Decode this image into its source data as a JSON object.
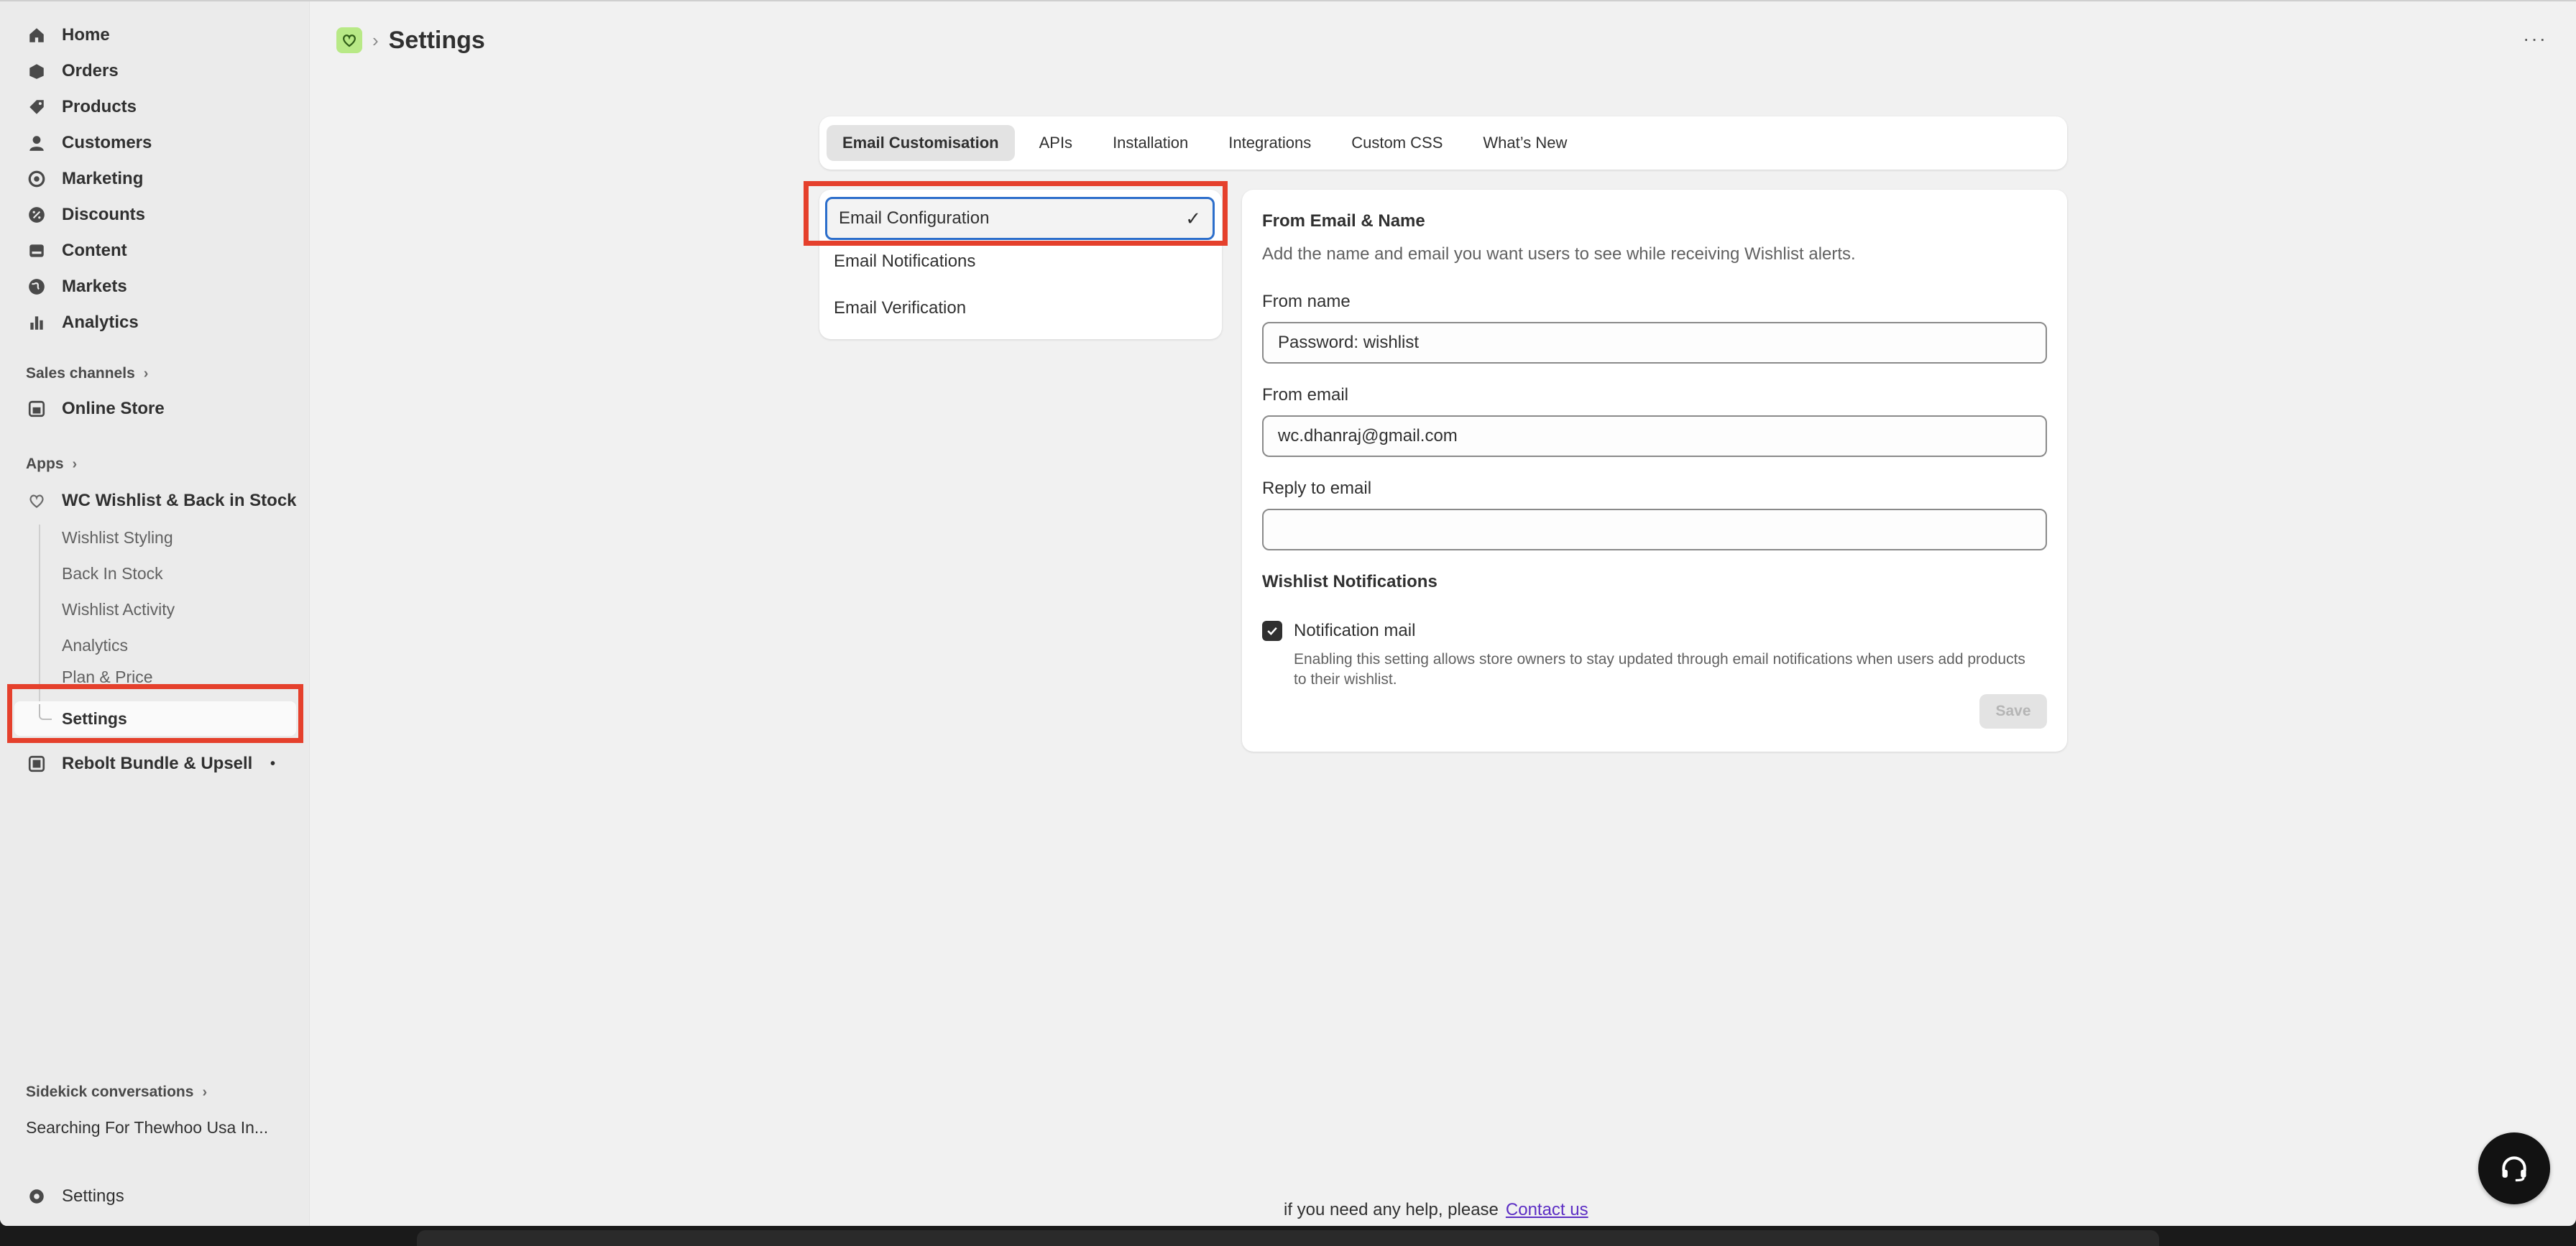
{
  "sidebar": {
    "nav": [
      {
        "label": "Home",
        "icon": "home-icon"
      },
      {
        "label": "Orders",
        "icon": "orders-icon"
      },
      {
        "label": "Products",
        "icon": "tag-icon"
      },
      {
        "label": "Customers",
        "icon": "person-icon"
      },
      {
        "label": "Marketing",
        "icon": "target-icon"
      },
      {
        "label": "Discounts",
        "icon": "discount-icon"
      },
      {
        "label": "Content",
        "icon": "content-icon"
      },
      {
        "label": "Markets",
        "icon": "globe-icon"
      },
      {
        "label": "Analytics",
        "icon": "bar-chart-icon"
      }
    ],
    "sales_channels_label": "Sales channels",
    "online_store": "Online Store",
    "apps_label": "Apps",
    "app_name": "WC Wishlist & Back in Stock",
    "app_subitems": [
      "Wishlist Styling",
      "Back In Stock",
      "Wishlist Activity",
      "Analytics",
      "Plan & Price",
      "Settings"
    ],
    "rebolt": "Rebolt Bundle & Upsell",
    "rebolt_dot": "•",
    "sidekick_label": "Sidekick conversations",
    "sidekick_item": "Searching For Thewhoo Usa In...",
    "bottom_settings": "Settings"
  },
  "header": {
    "sep": "›",
    "title": "Settings",
    "more": "···"
  },
  "tabs": [
    "Email Customisation",
    "APIs",
    "Installation",
    "Integrations",
    "Custom CSS",
    "What’s New"
  ],
  "email_menu": {
    "selected": "Email Configuration",
    "check": "✓",
    "items": [
      "Email Notifications",
      "Email Verification"
    ]
  },
  "form": {
    "heading": "From Email & Name",
    "description": "Add the name and email you want users to see while receiving Wishlist alerts.",
    "from_name_label": "From name",
    "from_name_value": "Password: wishlist",
    "from_email_label": "From email",
    "from_email_value": "wc.dhanraj@gmail.com",
    "reply_label": "Reply to email",
    "reply_value": "",
    "notifications_heading": "Wishlist Notifications",
    "checkbox_label": "Notification mail",
    "checkbox_checked": true,
    "help": "Enabling this setting allows store owners to stay updated through email notifications when users add products to their wishlist.",
    "save": "Save"
  },
  "footer": {
    "text": "if you need any help, please",
    "link": "Contact us"
  },
  "colors": {
    "highlight": "#e5402c",
    "focus": "#2c6ecb",
    "app_badge": "#b8e986"
  }
}
